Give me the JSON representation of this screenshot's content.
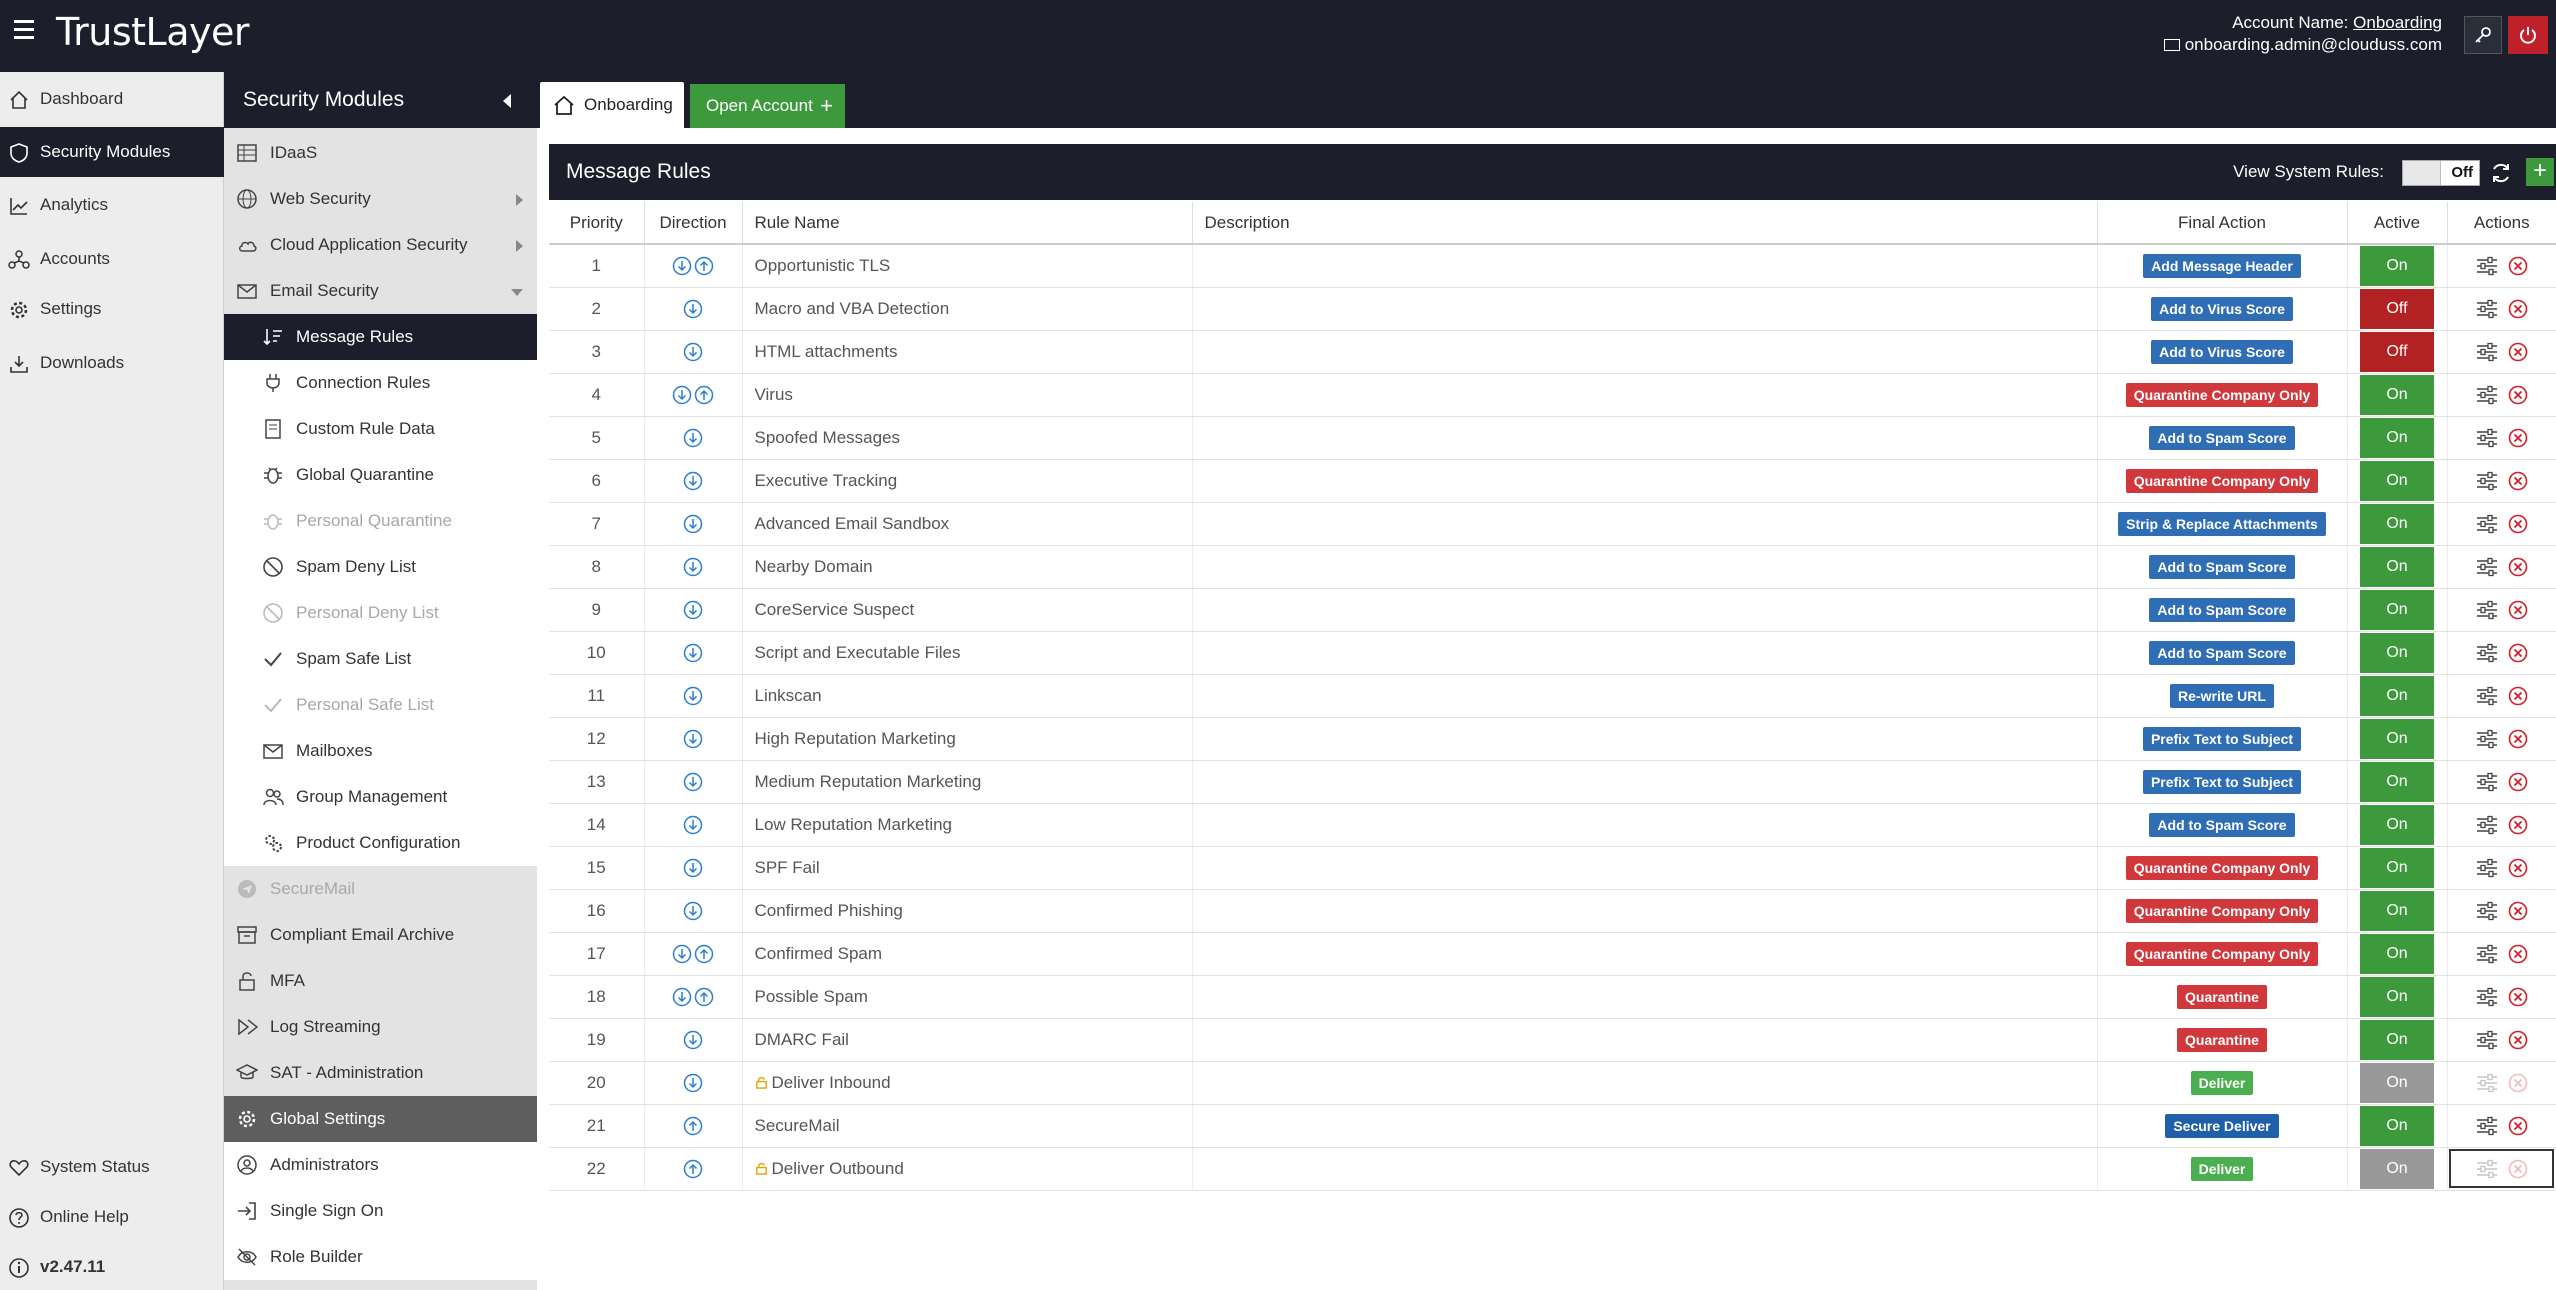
{
  "app": {
    "logo": "TrustLayer"
  },
  "account": {
    "label": "Account Name:",
    "name": "Onboarding",
    "email": "onboarding.admin@clouduss.com"
  },
  "leftnav": {
    "items": [
      {
        "label": "Dashboard",
        "icon": "home-icon"
      },
      {
        "label": "Security Modules",
        "icon": "shield-icon"
      },
      {
        "label": "Analytics",
        "icon": "chart-icon"
      },
      {
        "label": "Accounts",
        "icon": "accounts-icon"
      },
      {
        "label": "Settings",
        "icon": "gear-icon"
      },
      {
        "label": "Downloads",
        "icon": "download-icon"
      }
    ],
    "bottom": [
      {
        "label": "System Status",
        "icon": "heart-icon"
      },
      {
        "label": "Online Help",
        "icon": "question-icon"
      },
      {
        "label": "v2.47.11",
        "icon": "info-icon"
      }
    ]
  },
  "secpanel": {
    "title": "Security Modules",
    "items": [
      {
        "label": "IDaaS"
      },
      {
        "label": "Web Security"
      },
      {
        "label": "Cloud Application Security"
      },
      {
        "label": "Email Security"
      },
      {
        "label": "Message Rules"
      },
      {
        "label": "Connection Rules"
      },
      {
        "label": "Custom Rule Data"
      },
      {
        "label": "Global Quarantine"
      },
      {
        "label": "Personal Quarantine"
      },
      {
        "label": "Spam Deny List"
      },
      {
        "label": "Personal Deny List"
      },
      {
        "label": "Spam Safe List"
      },
      {
        "label": "Personal Safe List"
      },
      {
        "label": "Mailboxes"
      },
      {
        "label": "Group Management"
      },
      {
        "label": "Product Configuration"
      },
      {
        "label": "SecureMail"
      },
      {
        "label": "Compliant Email Archive"
      },
      {
        "label": "MFA"
      },
      {
        "label": "Log Streaming"
      },
      {
        "label": "SAT - Administration"
      },
      {
        "label": "Global Settings"
      },
      {
        "label": "Administrators"
      },
      {
        "label": "Single Sign On"
      },
      {
        "label": "Role Builder"
      }
    ]
  },
  "tabs": {
    "home": "Onboarding",
    "open": "Open Account"
  },
  "panel": {
    "title": "Message Rules",
    "view_system_rules": "View System Rules:",
    "toggle": "Off"
  },
  "table": {
    "headers": [
      "Priority",
      "Direction",
      "Rule Name",
      "Description",
      "Final Action",
      "Active",
      "Actions"
    ],
    "rows": [
      {
        "priority": "1",
        "dir": "both",
        "name": "Opportunistic TLS",
        "action": "Add Message Header",
        "color": "blue",
        "active": "On",
        "state": "on"
      },
      {
        "priority": "2",
        "dir": "in",
        "name": "Macro and VBA Detection",
        "action": "Add to Virus Score",
        "color": "blue",
        "active": "Off",
        "state": "off"
      },
      {
        "priority": "3",
        "dir": "in",
        "name": "HTML attachments",
        "action": "Add to Virus Score",
        "color": "blue",
        "active": "Off",
        "state": "off"
      },
      {
        "priority": "4",
        "dir": "both",
        "name": "Virus",
        "action": "Quarantine Company Only",
        "color": "red",
        "active": "On",
        "state": "on"
      },
      {
        "priority": "5",
        "dir": "in",
        "name": "Spoofed Messages",
        "action": "Add to Spam Score",
        "color": "blue",
        "active": "On",
        "state": "on"
      },
      {
        "priority": "6",
        "dir": "in",
        "name": "Executive Tracking",
        "action": "Quarantine Company Only",
        "color": "red",
        "active": "On",
        "state": "on"
      },
      {
        "priority": "7",
        "dir": "in",
        "name": "Advanced Email Sandbox",
        "action": "Strip & Replace Attachments",
        "color": "blue",
        "active": "On",
        "state": "on"
      },
      {
        "priority": "8",
        "dir": "in",
        "name": "Nearby Domain",
        "action": "Add to Spam Score",
        "color": "blue",
        "active": "On",
        "state": "on"
      },
      {
        "priority": "9",
        "dir": "in",
        "name": "CoreService Suspect",
        "action": "Add to Spam Score",
        "color": "blue",
        "active": "On",
        "state": "on"
      },
      {
        "priority": "10",
        "dir": "in",
        "name": "Script and Executable Files",
        "action": "Add to Spam Score",
        "color": "blue",
        "active": "On",
        "state": "on"
      },
      {
        "priority": "11",
        "dir": "in",
        "name": "Linkscan",
        "action": "Re-write URL",
        "color": "blue",
        "active": "On",
        "state": "on"
      },
      {
        "priority": "12",
        "dir": "in",
        "name": "High Reputation Marketing",
        "action": "Prefix Text to Subject",
        "color": "blue",
        "active": "On",
        "state": "on"
      },
      {
        "priority": "13",
        "dir": "in",
        "name": "Medium Reputation Marketing",
        "action": "Prefix Text to Subject",
        "color": "blue",
        "active": "On",
        "state": "on"
      },
      {
        "priority": "14",
        "dir": "in",
        "name": "Low Reputation Marketing",
        "action": "Add to Spam Score",
        "color": "blue",
        "active": "On",
        "state": "on"
      },
      {
        "priority": "15",
        "dir": "in",
        "name": "SPF Fail",
        "action": "Quarantine Company Only",
        "color": "red",
        "active": "On",
        "state": "on"
      },
      {
        "priority": "16",
        "dir": "in",
        "name": "Confirmed Phishing",
        "action": "Quarantine Company Only",
        "color": "red",
        "active": "On",
        "state": "on"
      },
      {
        "priority": "17",
        "dir": "both",
        "name": "Confirmed Spam",
        "action": "Quarantine Company Only",
        "color": "red",
        "active": "On",
        "state": "on"
      },
      {
        "priority": "18",
        "dir": "both",
        "name": "Possible Spam",
        "action": "Quarantine",
        "color": "red",
        "active": "On",
        "state": "on"
      },
      {
        "priority": "19",
        "dir": "in",
        "name": "DMARC Fail",
        "action": "Quarantine",
        "color": "red",
        "active": "On",
        "state": "on"
      },
      {
        "priority": "20",
        "dir": "in",
        "name": "Deliver Inbound",
        "action": "Deliver",
        "color": "green",
        "active": "On",
        "state": "gray",
        "locked": true
      },
      {
        "priority": "21",
        "dir": "out",
        "name": "SecureMail",
        "action": "Secure Deliver",
        "color": "navy",
        "active": "On",
        "state": "on"
      },
      {
        "priority": "22",
        "dir": "out",
        "name": "Deliver Outbound",
        "action": "Deliver",
        "color": "green",
        "active": "On",
        "state": "gray",
        "locked": true
      }
    ]
  }
}
